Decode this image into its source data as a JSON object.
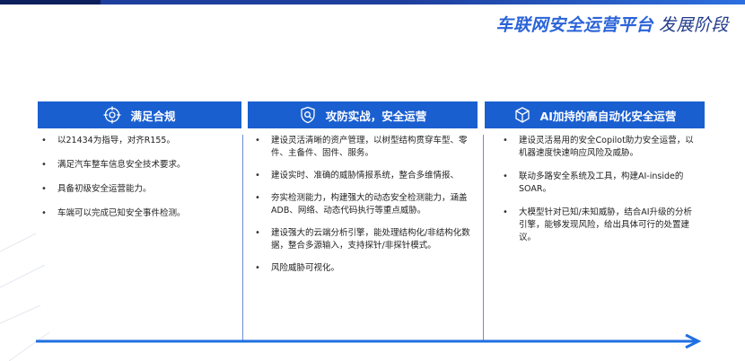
{
  "header": {
    "title": "车联网安全运营平台",
    "subtitle": "发展阶段"
  },
  "columns": [
    {
      "icon": "target-icon",
      "title": "满足合规",
      "items": [
        "以21434为指导，对齐R155。",
        "满足汽车整车信息安全技术要求。",
        "具备初级安全运营能力。",
        "车端可以完成已知安全事件检测。"
      ]
    },
    {
      "icon": "shield-search-icon",
      "title": "攻防实战，安全运营",
      "items": [
        "建设灵活清晰的资产管理，以树型结构贯穿车型、零件、主备件、固件、服务。",
        "建设实时、准确的威胁情报系统，整合多维情报、",
        "夯实检测能力，构建强大的动态安全检测能力，涵盖ADB、网络、动态代码执行等重点威胁。",
        "建设强大的云端分析引擎，能处理结构化/非结构化数据，整合多源输入，支持探针/非探针模式。",
        "风险威胁可视化。"
      ]
    },
    {
      "icon": "cube-icon",
      "title": "AI加持的高自动化安全运营",
      "items": [
        "建设灵活易用的安全Copilot助力安全运营，以机器速度快速响应风险及威胁。",
        "联动多路安全系统及工具，构建AI-inside的SOAR。",
        "大模型针对已知/未知威胁，结合AI升级的分析引擎，能够发现风险，给出具体可行的处置建议。"
      ]
    }
  ],
  "colors": {
    "header_blue": "#1a5fd0",
    "title_blue": "#2a63d8",
    "arrow_blue": "#1f6fe0"
  }
}
